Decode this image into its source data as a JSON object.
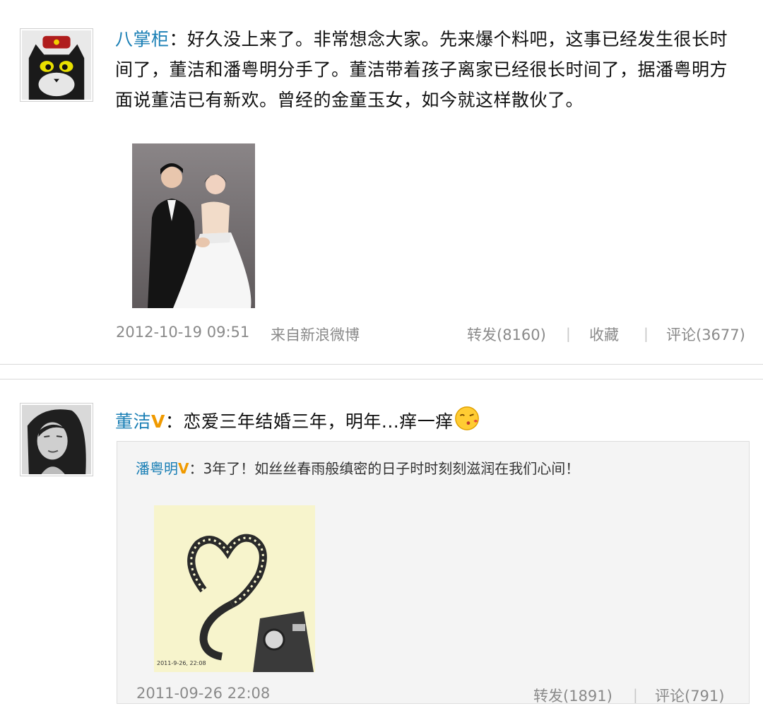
{
  "post1": {
    "author": "八掌柜",
    "content": "：好久没上来了。非常想念大家。先来爆个料吧，这事已经发生很长时间了，董洁和潘粤明分手了。董洁带着孩子离家已经很长时间了，据潘粤明方面说董洁已有新欢。曾经的金童玉女，如今就这样散伙了。",
    "timestamp": "2012-10-19 09:51",
    "source": "来自新浪微博",
    "repost": "转发(8160)",
    "favorite": "收藏",
    "comment": "评论(3677)"
  },
  "post2": {
    "author": "董洁",
    "verified": "V",
    "content": "：恋爱三年结婚三年，明年...痒一痒",
    "quote": {
      "author": "潘粤明",
      "verified": "V",
      "content": "：3年了！如丝丝春雨般缜密的日子时时刻刻滋润在我们心间！",
      "image_caption": "2011-9-26, 22:08",
      "timestamp": "2011-09-26 22:08",
      "repost": "转发(1891)",
      "comment": "评论(791)"
    }
  },
  "separator": "|",
  "colors": {
    "username": "#1a7fb5",
    "verified": "#f09a00",
    "meta": "#8a8a8a",
    "quote_bg": "#f4f4f4"
  },
  "icons": {
    "emoji": "kiss-emoji-icon",
    "verified": "verified-v-icon"
  }
}
